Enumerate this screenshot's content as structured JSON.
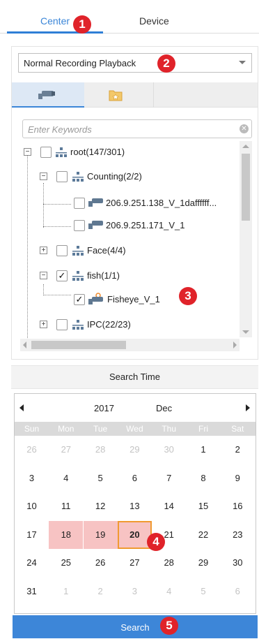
{
  "tabs": [
    {
      "label": "Center",
      "active": true
    },
    {
      "label": "Device",
      "active": false
    }
  ],
  "badges": [
    "1",
    "2",
    "3",
    "4",
    "5"
  ],
  "playback_select": {
    "value": "Normal Recording Playback"
  },
  "icon_tabs": [
    {
      "icon": "camera-icon",
      "active": true
    },
    {
      "icon": "folder-star-icon",
      "active": false
    }
  ],
  "search": {
    "placeholder": "Enter Keywords"
  },
  "tree": [
    {
      "label": "root(147/301)",
      "type": "group",
      "checked": false
    },
    {
      "label": "Counting(2/2)",
      "type": "group",
      "checked": false
    },
    {
      "label": "206.9.251.138_V_1daffffff...",
      "type": "camera",
      "checked": false
    },
    {
      "label": "206.9.251.171_V_1",
      "type": "camera",
      "checked": false
    },
    {
      "label": "Face(4/4)",
      "type": "group",
      "checked": false
    },
    {
      "label": "fish(1/1)",
      "type": "group",
      "checked": true
    },
    {
      "label": "Fisheye_V_1",
      "type": "fisheye-camera",
      "checked": true
    },
    {
      "label": "IPC(22/23)",
      "type": "group",
      "checked": false
    }
  ],
  "search_time": {
    "label": "Search Time"
  },
  "calendar": {
    "year": "2017",
    "month": "Dec",
    "weekdays": [
      "Sun",
      "Mon",
      "Tue",
      "Wed",
      "Thu",
      "Fri",
      "Sat"
    ],
    "weeks": [
      [
        "26",
        "27",
        "28",
        "29",
        "30",
        "1",
        "2"
      ],
      [
        "3",
        "4",
        "5",
        "6",
        "7",
        "8",
        "9"
      ],
      [
        "10",
        "11",
        "12",
        "13",
        "14",
        "15",
        "16"
      ],
      [
        "17",
        "18",
        "19",
        "20",
        "21",
        "22",
        "23"
      ],
      [
        "24",
        "25",
        "26",
        "27",
        "28",
        "29",
        "30"
      ],
      [
        "31",
        "1",
        "2",
        "3",
        "4",
        "5",
        "6"
      ]
    ],
    "selected_range": [
      "18",
      "19",
      "20"
    ],
    "today": "20"
  },
  "search_button": {
    "label": "Search"
  },
  "colors": {
    "accent": "#3d86d8",
    "badge": "#e0232a",
    "range_highlight": "#f7c3c3",
    "today_border": "#f09a31"
  }
}
